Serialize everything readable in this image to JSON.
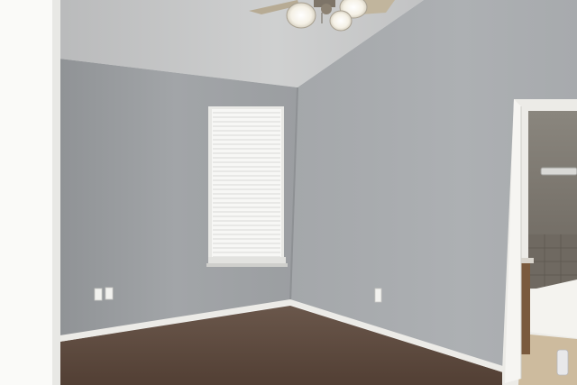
{
  "scene": {
    "kind": "photograph",
    "colors": {
      "left_wall": "#a3a6a9",
      "right_wall": "#a9acaf",
      "ceiling": "#c9cacb",
      "carpet": "#5f4c40",
      "trim": "#ecebe7",
      "window_blind": "#f5f5f3",
      "foreground_wall": "#fafaf8",
      "bath_tile": "#7f7b74"
    },
    "icons": [
      "ceiling-fan-icon",
      "window-blinds-icon",
      "power-outlet-icon",
      "doorway-icon"
    ]
  }
}
